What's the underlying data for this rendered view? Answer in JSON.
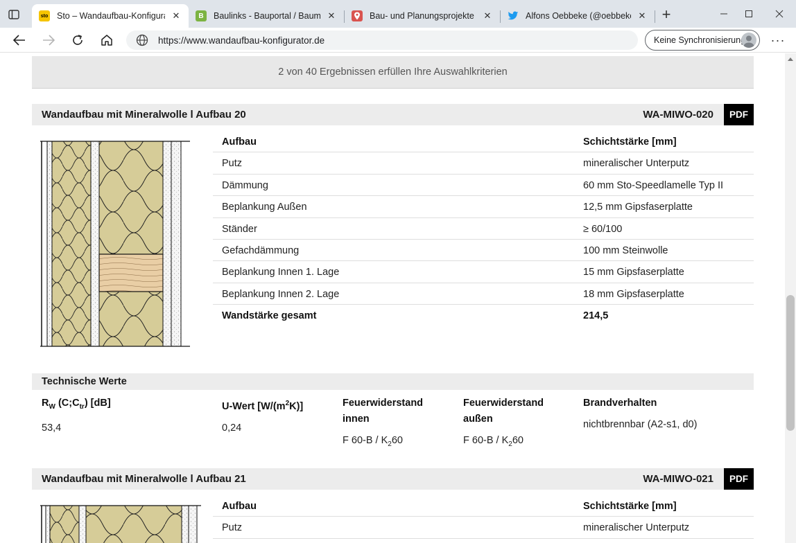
{
  "browser": {
    "tabs": [
      {
        "favicon_text": "sto",
        "favicon_bg": "#f5c400",
        "favicon_fg": "#000000",
        "title": "Sto – Wandaufbau-Konfigurator"
      },
      {
        "favicon_text": "B",
        "favicon_bg": "#7cb342",
        "favicon_fg": "#ffffff",
        "title": "Baulinks - Bauportal / Baumaga"
      },
      {
        "favicon_text": "",
        "favicon_bg": "#d9534f",
        "favicon_fg": "#ffffff",
        "title": "Bau- und Planungsprojekte auf"
      },
      {
        "favicon_text": "",
        "favicon_bg": "#1d9bf0",
        "favicon_fg": "#ffffff",
        "title": "Alfons Oebbeke (@oebbeke) / T"
      }
    ],
    "url": "https://www.wandaufbau-konfigurator.de",
    "sync_label": "Keine Synchronisierung"
  },
  "page": {
    "result_text": "2 von 40 Ergebnissen erfüllen Ihre Auswahlkriterien",
    "pdf_label": "PDF",
    "col_aufbau": "Aufbau",
    "col_schicht": "Schichtstärke [mm]",
    "items": [
      {
        "title": "Wandaufbau mit Mineralwolle l Aufbau 20",
        "code": "WA-MIWO-020",
        "layers": [
          {
            "name": "Putz",
            "value": "mineralischer Unterputz"
          },
          {
            "name": "Dämmung",
            "value": "60 mm Sto-Speedlamelle Typ II"
          },
          {
            "name": "Beplankung Außen",
            "value": "12,5 mm Gipsfaserplatte"
          },
          {
            "name": "Ständer",
            "value": "≥ 60/100"
          },
          {
            "name": "Gefachdämmung",
            "value": "100 mm Steinwolle"
          },
          {
            "name": "Beplankung Innen 1. Lage",
            "value": "15 mm Gipsfaserplatte"
          },
          {
            "name": "Beplankung Innen 2. Lage",
            "value": "18 mm Gipsfaserplatte"
          }
        ],
        "total": {
          "name": "Wandstärke gesamt",
          "value": "214,5"
        }
      },
      {
        "title": "Wandaufbau mit Mineralwolle l Aufbau 21",
        "code": "WA-MIWO-021",
        "layers": [
          {
            "name": "Putz",
            "value": "mineralischer Unterputz"
          }
        ]
      }
    ],
    "tech": {
      "title": "Technische Werte",
      "rw_label_main": "R",
      "rw_label_sub": "W",
      "rw_label_mid": " (C;C",
      "rw_label_sub2": "tr",
      "rw_label_end": ") [dB]",
      "rw_value": "53,4",
      "u_label_main": "U-Wert [W/(m",
      "u_label_sup": "2",
      "u_label_end": "K)]",
      "u_value": "0,24",
      "fw_innen_label": "Feuerwiderstand innen",
      "fw_innen_val_a": "F 60-B / K",
      "fw_innen_val_sub": "2",
      "fw_innen_val_b": "60",
      "fw_aussen_label": "Feuerwiderstand außen",
      "fw_aussen_val_a": "F 60-B / K",
      "fw_aussen_val_sub": "2",
      "fw_aussen_val_b": "60",
      "brand_label": "Brandverhalten",
      "brand_value": "nichtbrennbar (A2-s1, d0)"
    }
  }
}
